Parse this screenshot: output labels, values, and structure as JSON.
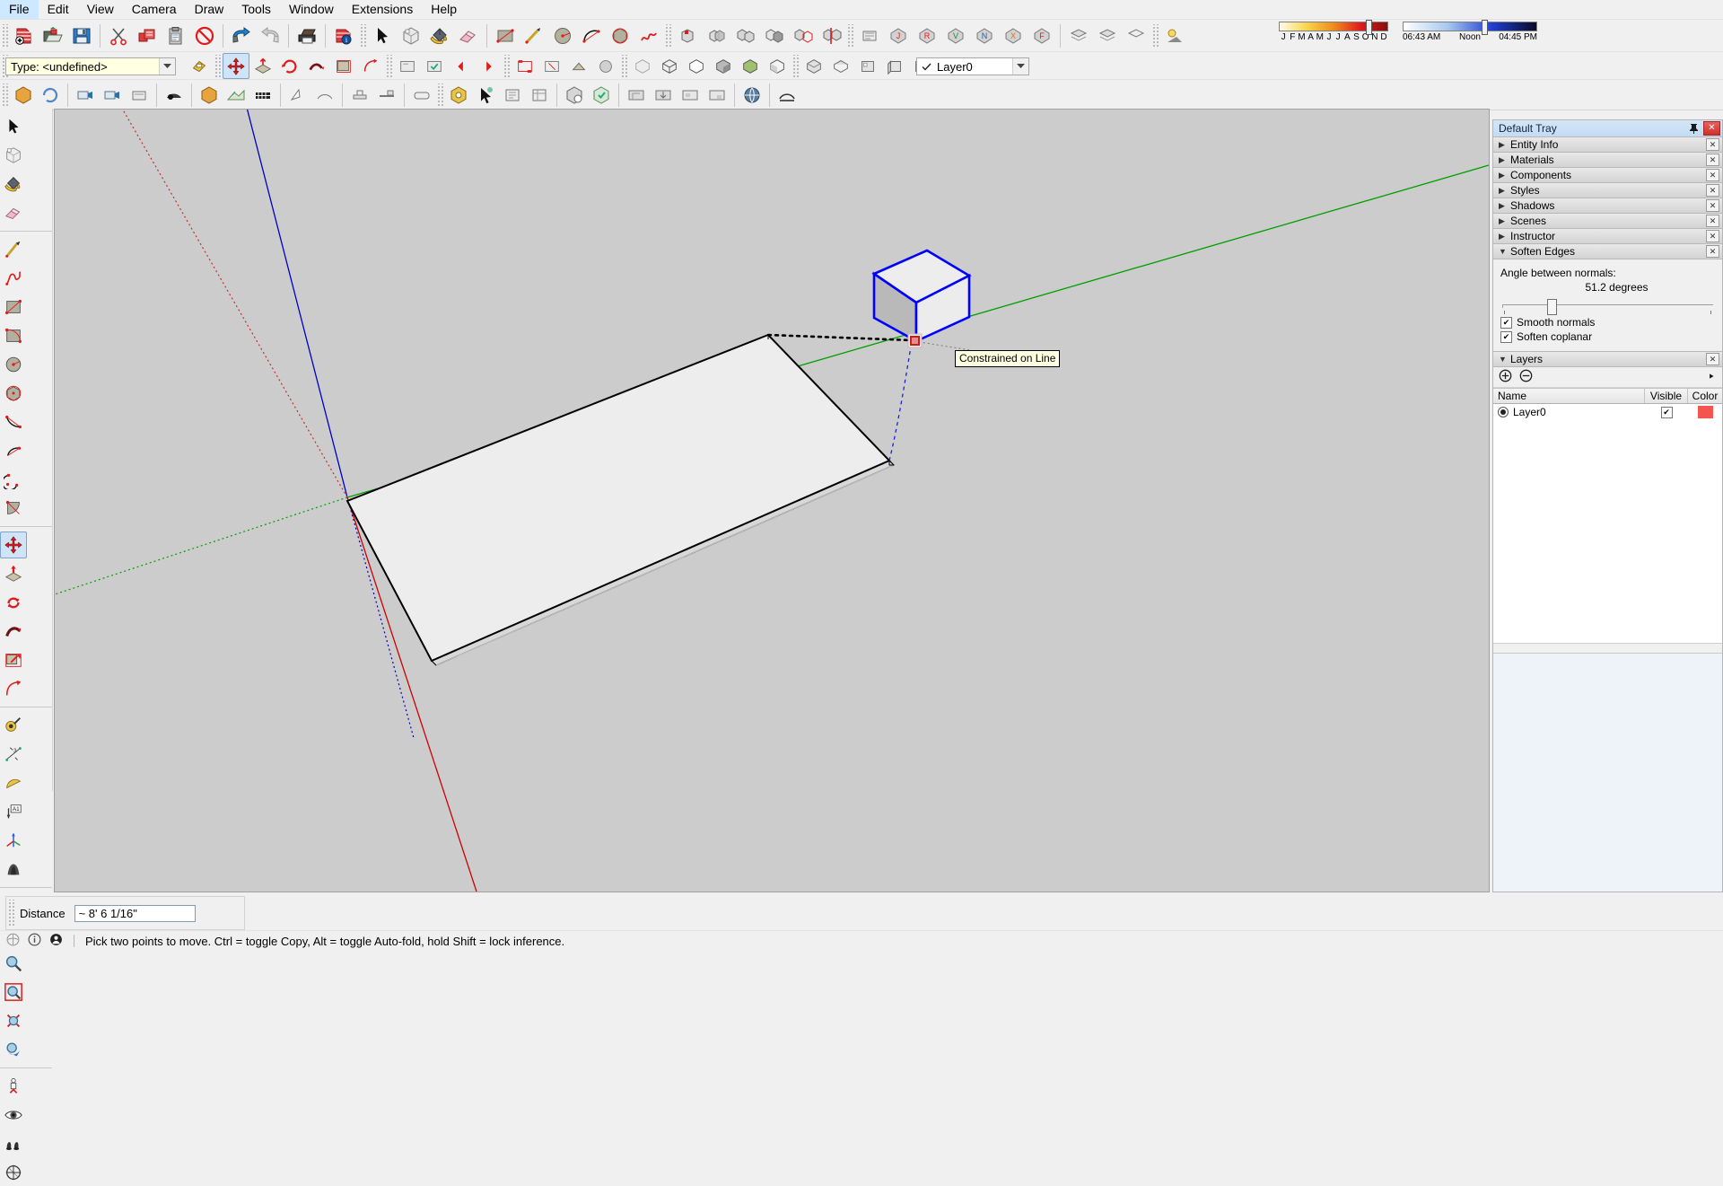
{
  "app": {
    "title": "SketchUp"
  },
  "menubar": {
    "items": [
      {
        "label": "File"
      },
      {
        "label": "Edit"
      },
      {
        "label": "View"
      },
      {
        "label": "Camera"
      },
      {
        "label": "Draw"
      },
      {
        "label": "Tools"
      },
      {
        "label": "Window"
      },
      {
        "label": "Extensions"
      },
      {
        "label": "Help"
      }
    ]
  },
  "toolbars": {
    "standard": [
      {
        "name": "new-document-button",
        "title": "New"
      },
      {
        "name": "open-document-button",
        "title": "Open"
      },
      {
        "name": "save-document-button",
        "title": "Save"
      },
      {
        "name": "cut-button",
        "title": "Cut"
      },
      {
        "name": "copy-button",
        "title": "Copy"
      },
      {
        "name": "paste-button",
        "title": "Paste"
      },
      {
        "name": "erase-button",
        "title": "Erase"
      },
      {
        "name": "undo-button",
        "title": "Undo"
      },
      {
        "name": "redo-button",
        "title": "Redo"
      },
      {
        "name": "print-button",
        "title": "Print"
      },
      {
        "name": "model-info-button",
        "title": "Model Info"
      }
    ],
    "principal": [
      {
        "name": "select-tool-button",
        "title": "Select"
      },
      {
        "name": "make-component-button",
        "title": "Make Component"
      },
      {
        "name": "paint-bucket-button",
        "title": "Paint Bucket"
      },
      {
        "name": "eraser-button",
        "title": "Eraser"
      }
    ],
    "drawing": [
      {
        "name": "rectangle-tool-button",
        "title": "Rectangle"
      },
      {
        "name": "line-tool-button",
        "title": "Line"
      },
      {
        "name": "circle-tool-button",
        "title": "Circle"
      },
      {
        "name": "arc-tool-button",
        "title": "Arc"
      },
      {
        "name": "polygon-tool-button",
        "title": "Polygon"
      },
      {
        "name": "freehand-tool-button",
        "title": "Freehand"
      }
    ],
    "solid_tools": [
      {
        "name": "outer-shell-button",
        "title": "Outer Shell"
      },
      {
        "name": "intersect-button",
        "title": "Intersect"
      },
      {
        "name": "union-button",
        "title": "Union"
      },
      {
        "name": "subtract-button",
        "title": "Subtract"
      },
      {
        "name": "trim-button",
        "title": "Trim"
      },
      {
        "name": "split-button",
        "title": "Split"
      }
    ],
    "views": [
      {
        "name": "iso-view-button",
        "title": "Iso"
      },
      {
        "name": "top-view-button",
        "title": "Top"
      },
      {
        "name": "front-view-button",
        "title": "Front"
      },
      {
        "name": "right-view-button",
        "title": "Right"
      },
      {
        "name": "back-view-button",
        "title": "Back"
      },
      {
        "name": "left-view-button",
        "title": "Left"
      }
    ],
    "styles": [
      {
        "name": "xray-style-button",
        "title": "X-Ray"
      },
      {
        "name": "wireframe-style-button",
        "title": "Wireframe"
      },
      {
        "name": "hidden-line-style-button",
        "title": "Hidden Line"
      },
      {
        "name": "shaded-style-button",
        "title": "Shaded"
      },
      {
        "name": "shaded-texture-style-button",
        "title": "Shaded With Textures"
      },
      {
        "name": "monochrome-style-button",
        "title": "Monochrome"
      }
    ],
    "warehouse": [
      {
        "name": "warehouse-get-models-button",
        "title": "3D Warehouse"
      },
      {
        "name": "warehouse-share-model-button",
        "title": "Share Model"
      },
      {
        "name": "extension-warehouse-button",
        "title": "Extension Warehouse"
      }
    ],
    "sections": [
      {
        "name": "section-plane-button",
        "title": "Section Plane"
      },
      {
        "name": "display-section-planes-button",
        "title": "Display Section Planes"
      },
      {
        "name": "display-section-cuts-button",
        "title": "Display Section Cuts"
      },
      {
        "name": "display-section-fill-button",
        "title": "Display Section Fill"
      }
    ],
    "shadows": [
      {
        "name": "shadow-settings-button",
        "title": "Shadow Settings"
      },
      {
        "name": "show-shadows-button",
        "title": "Show / Hide Shadows"
      }
    ],
    "walkthrough": [
      {
        "name": "position-camera-button",
        "title": "Position Camera"
      },
      {
        "name": "look-around-button",
        "title": "Look Around"
      },
      {
        "name": "walk-button",
        "title": "Walk"
      }
    ]
  },
  "type_combo": {
    "name": "type-combo",
    "value": "Type: <undefined>"
  },
  "layer_combo": {
    "name": "layer-combo",
    "value": "Layer0"
  },
  "shadow_sliders": {
    "months": [
      "J",
      "F",
      "M",
      "A",
      "M",
      "J",
      "J",
      "A",
      "S",
      "O",
      "N",
      "D"
    ],
    "month_position_percent": 80,
    "time_start": "06:43 AM",
    "time_mid": "Noon",
    "time_end": "04:45 PM",
    "time_position_percent": 60
  },
  "left_toolset": {
    "title": "Large Tool Set",
    "tools": [
      {
        "name": "select-tool",
        "title": "Select",
        "selected": false
      },
      {
        "name": "make-component-tool",
        "title": "Make Component",
        "selected": false
      },
      {
        "name": "paint-bucket-tool",
        "title": "Paint Bucket",
        "selected": false
      },
      {
        "name": "eraser-tool",
        "title": "Eraser",
        "selected": false
      },
      {
        "name": "line-tool",
        "title": "Line",
        "selected": false
      },
      {
        "name": "freehand-tool",
        "title": "Freehand",
        "selected": false
      },
      {
        "name": "rectangle-tool",
        "title": "Rectangle",
        "selected": false
      },
      {
        "name": "rotated-rectangle-tool",
        "title": "Rotated Rectangle",
        "selected": false
      },
      {
        "name": "circle-tool",
        "title": "Circle",
        "selected": false
      },
      {
        "name": "polygon-tool",
        "title": "Polygon",
        "selected": false
      },
      {
        "name": "arc-tool",
        "title": "Arc",
        "selected": false
      },
      {
        "name": "two-point-arc-tool",
        "title": "2 Point Arc",
        "selected": false
      },
      {
        "name": "three-point-arc-tool",
        "title": "3 Point Arc",
        "selected": false
      },
      {
        "name": "pie-tool",
        "title": "Pie",
        "selected": false
      },
      {
        "name": "move-tool",
        "title": "Move",
        "selected": true
      },
      {
        "name": "push-pull-tool",
        "title": "Push/Pull",
        "selected": false
      },
      {
        "name": "rotate-tool",
        "title": "Rotate",
        "selected": false
      },
      {
        "name": "follow-me-tool",
        "title": "Follow Me",
        "selected": false
      },
      {
        "name": "scale-tool",
        "title": "Scale",
        "selected": false
      },
      {
        "name": "offset-tool",
        "title": "Offset",
        "selected": false
      },
      {
        "name": "tape-measure-tool",
        "title": "Tape Measure",
        "selected": false
      },
      {
        "name": "dimension-tool",
        "title": "Dimension",
        "selected": false
      },
      {
        "name": "protractor-tool",
        "title": "Protractor",
        "selected": false
      },
      {
        "name": "text-tool",
        "title": "Text",
        "selected": false
      },
      {
        "name": "axes-tool",
        "title": "Axes",
        "selected": false
      },
      {
        "name": "three-d-text-tool",
        "title": "3D Text",
        "selected": false
      },
      {
        "name": "orbit-tool",
        "title": "Orbit",
        "selected": false
      },
      {
        "name": "pan-tool",
        "title": "Pan",
        "selected": false
      },
      {
        "name": "zoom-tool",
        "title": "Zoom",
        "selected": false
      },
      {
        "name": "zoom-window-tool",
        "title": "Zoom Window",
        "selected": false
      },
      {
        "name": "zoom-extents-tool",
        "title": "Zoom Extents",
        "selected": false
      },
      {
        "name": "previous-view-tool",
        "title": "Previous View",
        "selected": false
      },
      {
        "name": "position-camera-tool",
        "title": "Position Camera",
        "selected": false
      },
      {
        "name": "look-around-tool",
        "title": "Look Around",
        "selected": false
      },
      {
        "name": "walk-tool",
        "title": "Walk",
        "selected": false
      },
      {
        "name": "section-plane-tool",
        "title": "Section Plane",
        "selected": false
      }
    ]
  },
  "canvas": {
    "tooltip": "Constrained on Line",
    "background_color": "#cccccc",
    "selection_color": "#0000ff",
    "axis_red": "#ff0000",
    "axis_green": "#00a000",
    "axis_blue": "#0000c0"
  },
  "tray": {
    "title": "Default Tray",
    "pin_icon": "pin-icon",
    "close_icon": "close-icon",
    "panels": [
      {
        "label": "Entity Info",
        "expanded": false
      },
      {
        "label": "Materials",
        "expanded": false
      },
      {
        "label": "Components",
        "expanded": false
      },
      {
        "label": "Styles",
        "expanded": false
      },
      {
        "label": "Shadows",
        "expanded": false
      },
      {
        "label": "Scenes",
        "expanded": false
      },
      {
        "label": "Instructor",
        "expanded": false
      },
      {
        "label": "Soften Edges",
        "expanded": true
      }
    ],
    "soften_edges": {
      "angle_label": "Angle between normals:",
      "angle_value": "51.2  degrees",
      "slider_percent": 32,
      "smooth_normals_label": "Smooth normals",
      "smooth_normals_checked": true,
      "soften_coplanar_label": "Soften coplanar",
      "soften_coplanar_checked": true
    },
    "layers": {
      "panel_label": "Layers",
      "add_button": "add-layer-button",
      "remove_button": "remove-layer-button",
      "details_button": "layer-details-button",
      "columns": [
        "Name",
        "Visible",
        "Color"
      ],
      "rows": [
        {
          "name": "Layer0",
          "visible": true,
          "color": "#f4554f",
          "active": true
        }
      ]
    }
  },
  "measurements": {
    "label": "Distance",
    "value": "~ 8' 6 1/16\"",
    "name": "measurements-input"
  },
  "status_bar": {
    "message": "Pick two points to move.  Ctrl = toggle Copy, Alt = toggle Auto-fold, hold Shift = lock inference.",
    "icons": [
      "geo-location-icon",
      "info-icon",
      "person-icon"
    ]
  }
}
